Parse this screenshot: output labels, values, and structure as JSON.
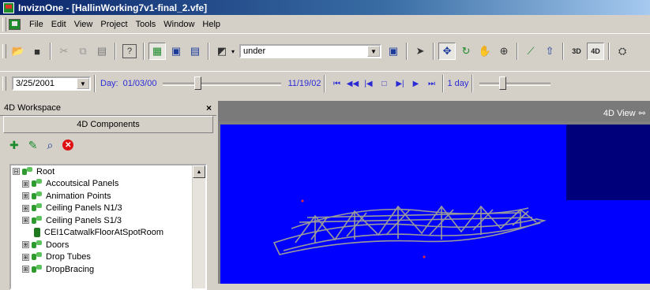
{
  "window": {
    "title": "InviznOne - [HallinWorking7v1-final_2.vfe]"
  },
  "menubar": {
    "items": [
      "File",
      "Edit",
      "View",
      "Project",
      "Tools",
      "Window",
      "Help"
    ]
  },
  "toolbar": {
    "filter_value": "under",
    "buttons": [
      "open-folder",
      "save",
      "cut",
      "copy",
      "paste",
      "help",
      "view-mode",
      "panel",
      "grid",
      "3d-box",
      "filter-apply",
      "select-arrow",
      "move",
      "rotate",
      "pan",
      "zoom",
      "measure",
      "navigate",
      "3d",
      "4d",
      "build"
    ],
    "btn_3d": "3D",
    "btn_4d": "4D"
  },
  "timeline": {
    "date_value": "3/25/2001",
    "day_label": "Day:",
    "start_date": "01/03/00",
    "end_date": "11/19/02",
    "step_label": "1 day",
    "slider_position": 0.28,
    "step_slider_position": 0.3
  },
  "workspace": {
    "title": "4D Workspace",
    "close": "×",
    "subheader": "4D Components",
    "tree": [
      {
        "label": "Root",
        "type": "group",
        "expander": "⊟",
        "level": 0
      },
      {
        "label": "Accoutsical Panels",
        "type": "group",
        "expander": "⊞",
        "level": 1
      },
      {
        "label": "Animation Points",
        "type": "group",
        "expander": "⊞",
        "level": 1
      },
      {
        "label": "Ceiling Panels N1/3",
        "type": "group",
        "expander": "⊞",
        "level": 1
      },
      {
        "label": "Ceiling Panels S1/3",
        "type": "group",
        "expander": "⊞",
        "level": 1
      },
      {
        "label": "CEI1CatwalkFloorAtSpotRoom",
        "type": "object",
        "expander": "",
        "level": 1
      },
      {
        "label": "Doors",
        "type": "group",
        "expander": "⊞",
        "level": 1
      },
      {
        "label": "Drop Tubes",
        "type": "group",
        "expander": "⊞",
        "level": 1
      },
      {
        "label": "DropBracing",
        "type": "group",
        "expander": "⊞",
        "level": 1
      }
    ]
  },
  "view": {
    "title": "4D View"
  },
  "colors": {
    "canvas": "#0000ff",
    "canvas_corner": "#00007a",
    "titlebar": "#0a246a",
    "blue_text": "#2b2bd6"
  }
}
